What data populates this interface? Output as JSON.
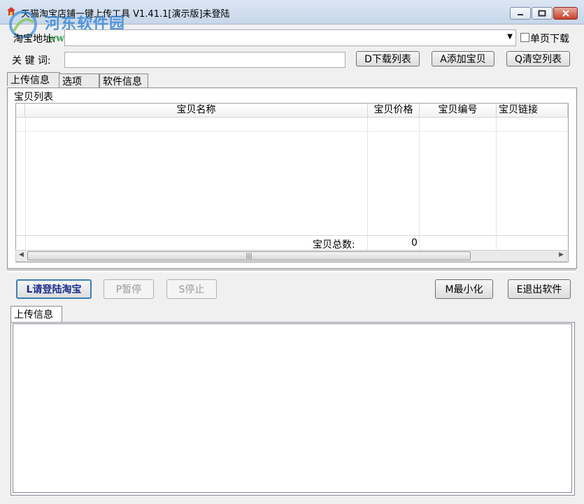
{
  "window": {
    "title": "天猫淘宝店铺一键上传工具 V1.41.1[演示版]未登陆"
  },
  "watermark": {
    "site_name": "河东软件园",
    "url": "www.pc0359.cn"
  },
  "form": {
    "address_label": "淘宝地址:",
    "address_value": "",
    "single_page_label": "单页下载",
    "keyword_label": "关 键 词:",
    "keyword_value": ""
  },
  "toolbar": {
    "download_list": "D下载列表",
    "add_item": "A添加宝贝",
    "clear_list": "Q清空列表"
  },
  "tabs": [
    {
      "label": "上传信息"
    },
    {
      "label": "选项"
    },
    {
      "label": "软件信息"
    }
  ],
  "item_list": {
    "group_label": "宝贝列表",
    "columns": [
      "宝贝名称",
      "宝贝价格",
      "宝贝编号",
      "宝贝链接"
    ],
    "rows": [],
    "total_label": "宝贝总数:",
    "total_value": "0"
  },
  "actions": {
    "login": "L请登陆淘宝",
    "pause": "P暂停",
    "stop": "S停止",
    "minimize": "M最小化",
    "exit": "E退出软件"
  },
  "log": {
    "tab_label": "上传信息",
    "content": ""
  }
}
